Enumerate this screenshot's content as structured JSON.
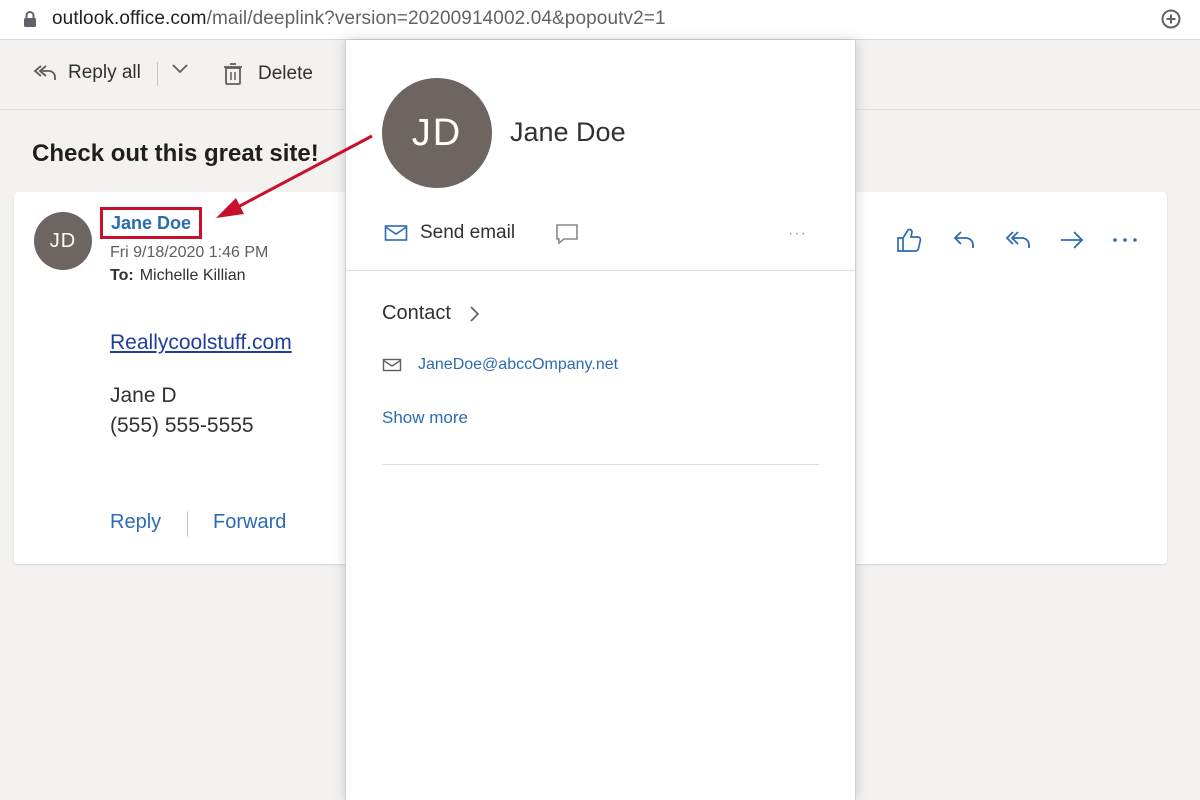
{
  "browser": {
    "url_host": "outlook.office.com",
    "url_path": "/mail/deeplink?version=20200914002.04&popoutv2=1"
  },
  "toolbar": {
    "reply_all_label": "Reply all",
    "delete_label": "Delete"
  },
  "message": {
    "subject": "Check out this great site!",
    "avatar_initials": "JD",
    "sender_name": "Jane Doe",
    "datetime": "Fri 9/18/2020 1:46 PM",
    "to_label": "To:",
    "to_name": "Michelle Killian",
    "body_link": "Reallycoolstuff.com",
    "signature_name": "Jane D",
    "signature_phone": "(555) 555-5555",
    "reply_label": "Reply",
    "forward_label": "Forward"
  },
  "contact_card": {
    "avatar_initials": "JD",
    "name": "Jane Doe",
    "send_email_label": "Send email",
    "more_label": "···",
    "contact_heading": "Contact",
    "email": "JaneDoe@abccOmpany.net",
    "show_more_label": "Show more"
  },
  "colors": {
    "accent": "#2b6cb0",
    "avatar": "#6e6461",
    "annotation": "#c8102e"
  },
  "icons": {
    "lock": "lock-icon",
    "zoom": "zoom-icon",
    "reply_all": "reply-all-icon",
    "chevron": "chevron-down-icon",
    "delete": "trash-icon",
    "like": "thumbs-up-icon",
    "reply": "reply-icon",
    "forward": "forward-icon",
    "more": "more-icon",
    "mail": "mail-icon",
    "chat": "chat-icon"
  }
}
